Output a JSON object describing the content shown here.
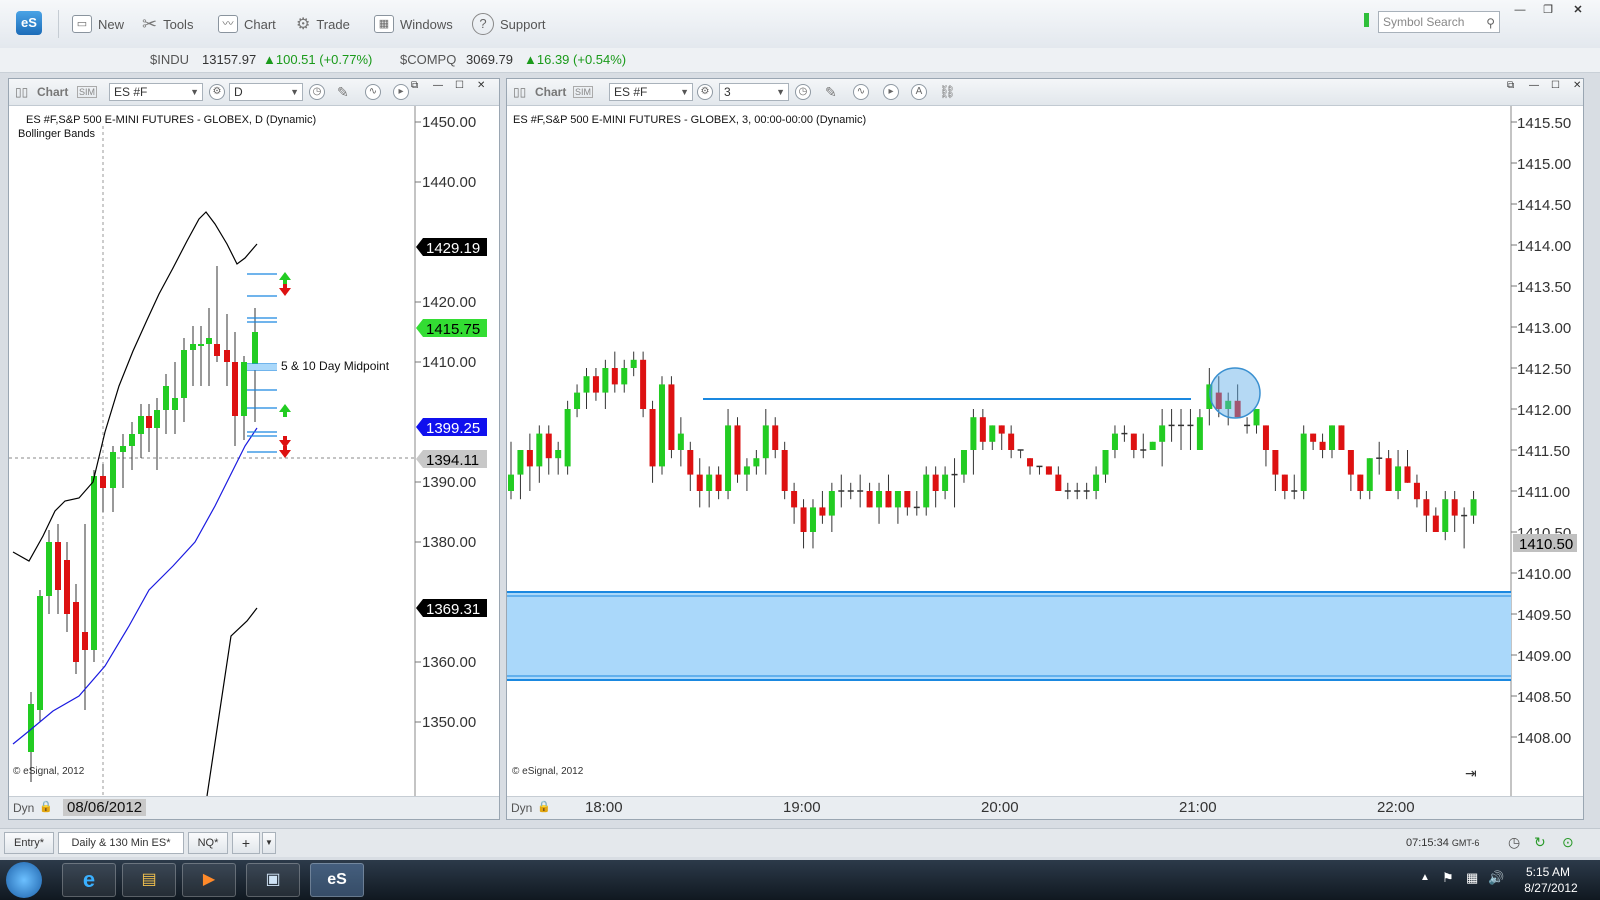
{
  "toolbar": {
    "logo": "eS",
    "new": "New",
    "tools": "Tools",
    "chart": "Chart",
    "trade": "Trade",
    "windows": "Windows",
    "support": "Support",
    "search_placeholder": "Symbol Search"
  },
  "quotes": [
    {
      "symbol": "$INDU",
      "price": "13157.97",
      "change": "100.51 (+0.77%)"
    },
    {
      "symbol": "$COMPQ",
      "price": "3069.79",
      "change": "16.39 (+0.54%)"
    }
  ],
  "left_chart": {
    "panel_label": "Chart",
    "symbol": "ES #F",
    "interval": "D",
    "title": "ES #F,S&P 500 E-MINI FUTURES - GLOBEX, D (Dynamic)",
    "study": "Bollinger Bands",
    "annotation": "5 & 10 Day Midpoint",
    "copyright": "© eSignal, 2012",
    "dyn": "Dyn",
    "date": "08/06/2012",
    "price_ticks": [
      "1450.00",
      "1440.00",
      "1420.00",
      "1410.00",
      "1390.00",
      "1380.00",
      "1360.00",
      "1350.00"
    ],
    "tags": [
      {
        "text": "1429.19",
        "bg": "#000000",
        "fg": "#ffffff"
      },
      {
        "text": "1415.75",
        "bg": "#33dd33",
        "fg": "#000000"
      },
      {
        "text": "1399.25",
        "bg": "#1010ee",
        "fg": "#ffffff"
      },
      {
        "text": "1394.11",
        "bg": "#c8c8c8",
        "fg": "#000000"
      },
      {
        "text": "1369.31",
        "bg": "#000000",
        "fg": "#ffffff"
      }
    ]
  },
  "right_chart": {
    "panel_label": "Chart",
    "symbol": "ES #F",
    "interval": "3",
    "title": "ES #F,S&P 500 E-MINI FUTURES - GLOBEX, 3, 00:00-00:00 (Dynamic)",
    "copyright": "© eSignal, 2012",
    "dyn": "Dyn",
    "price_ticks": [
      "1415.50",
      "1415.00",
      "1414.50",
      "1414.00",
      "1413.50",
      "1413.00",
      "1412.50",
      "1412.00",
      "1411.50",
      "1411.00",
      "1410.50",
      "1410.00",
      "1409.50",
      "1409.00",
      "1408.50",
      "1408.00"
    ],
    "last_tag": "1410.50",
    "time_ticks": [
      "18:00",
      "19:00",
      "20:00",
      "21:00",
      "22:00"
    ]
  },
  "tabs": [
    "Entry*",
    "Daily & 130 Min ES*",
    "NQ*"
  ],
  "status": {
    "clock": "07:15:34",
    "tz": "GMT-6"
  },
  "taskbar": {
    "time": "5:15 AM",
    "date": "8/27/2012"
  },
  "colors": {
    "up": "#22cc22",
    "down": "#dd1111",
    "zone": "#aad8fa"
  }
}
